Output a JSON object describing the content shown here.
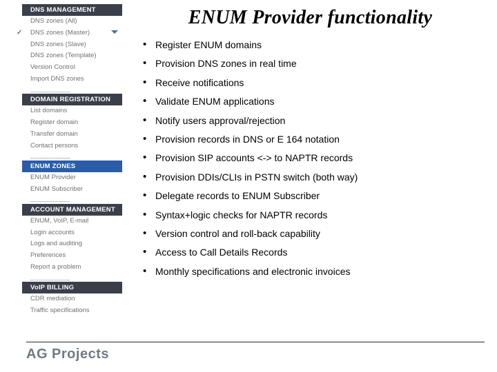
{
  "title": "ENUM Provider functionality",
  "sidebar": {
    "sections": [
      {
        "header": "DNS MANAGEMENT",
        "active": false,
        "items": [
          {
            "label": "DNS zones (All)",
            "checked": false
          },
          {
            "label": "DNS zones (Master)",
            "checked": true,
            "arrow": true
          },
          {
            "label": "DNS zones (Slave)",
            "checked": false
          },
          {
            "label": "DNS zones (Template)",
            "checked": false
          },
          {
            "label": "Version Control",
            "checked": false
          },
          {
            "label": "Import DNS zones",
            "checked": false
          }
        ]
      },
      {
        "header": "DOMAIN REGISTRATION",
        "active": false,
        "items": [
          {
            "label": "List domains"
          },
          {
            "label": "Register domain"
          },
          {
            "label": "Transfer domain"
          },
          {
            "label": "Contact persons"
          }
        ]
      },
      {
        "header": "ENUM ZONES",
        "active": true,
        "items": [
          {
            "label": "ENUM Provider"
          },
          {
            "label": "ENUM Subscriber"
          }
        ]
      },
      {
        "header": "ACCOUNT MANAGEMENT",
        "active": false,
        "items": [
          {
            "label": "ENUM, VoIP, E-mail"
          },
          {
            "label": "Login accounts"
          },
          {
            "label": "Logs and auditing"
          },
          {
            "label": "Preferences"
          },
          {
            "label": "Report a problem"
          }
        ]
      },
      {
        "header": "VoIP BILLING",
        "active": false,
        "items": [
          {
            "label": "CDR mediation"
          },
          {
            "label": "Traffic specifications"
          }
        ]
      }
    ],
    "sep": "__________"
  },
  "bullets": [
    "Register ENUM domains",
    "Provision DNS zones in real time",
    "Receive notifications",
    "Validate ENUM applications",
    "Notify users approval/rejection",
    "Provision records in DNS or E 164  notation",
    "Provision SIP accounts <-> to NAPTR records",
    "Provision DDIs/CLIs in PSTN switch (both way)",
    "Delegate records to ENUM Subscriber",
    "Syntax+logic checks for NAPTR records",
    "Version control and roll-back capability",
    "Access to Call Details Records",
    "Monthly specifications and electronic invoices"
  ],
  "footer": {
    "brand": "AG Projects"
  }
}
